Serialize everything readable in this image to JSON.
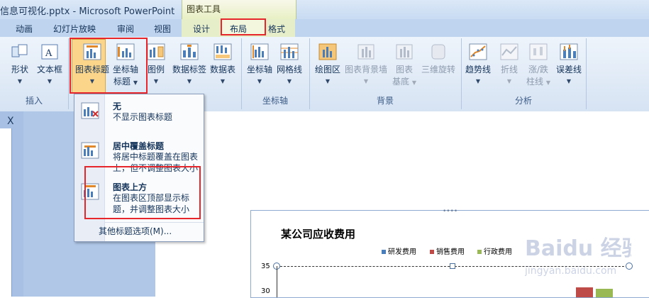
{
  "window": {
    "title": "信息可视化.pptx - Microsoft PowerPoint",
    "context_tab_group": "图表工具"
  },
  "tabs": [
    "动画",
    "幻灯片放映",
    "审阅",
    "视图",
    "设计",
    "布局",
    "格式"
  ],
  "active_tab": "布局",
  "ribbon": {
    "groups": {
      "insert": {
        "label": "插入",
        "shape": "形状",
        "textbox": "文本框"
      },
      "labels": {
        "chart_title_1": "图表标题",
        "axis_title_1": "坐标轴",
        "axis_title_2": "标题",
        "legend": "图例",
        "data_labels": "数据标签",
        "data_table": "数据表"
      },
      "axes": {
        "label": "坐标轴",
        "axes": "坐标轴",
        "gridlines": "网格线"
      },
      "background": {
        "label": "背景",
        "plot_area": "绘图区",
        "chart_wall": "图表背景墙",
        "chart_floor_1": "图表",
        "chart_floor_2": "基底",
        "rotation_3d": "三维旋转"
      },
      "analysis": {
        "label": "分析",
        "trendline": "趋势线",
        "lines": "折线",
        "updown_1": "涨/跌",
        "updown_2": "柱线",
        "error_bars": "误差线"
      }
    }
  },
  "menu": {
    "items": [
      {
        "heading": "无",
        "desc": "不显示图表标题"
      },
      {
        "heading": "居中覆盖标题",
        "desc": "将居中标题覆盖在图表上，但不调整图表大小"
      },
      {
        "heading": "图表上方",
        "desc": "在图表区顶部显示标题，并调整图表大小"
      }
    ],
    "more": "其他标题选项(M)..."
  },
  "chart": {
    "title": "某公司应收费用",
    "legend": [
      {
        "name": "研发费用",
        "color": "#4a7ebb"
      },
      {
        "name": "销售费用",
        "color": "#be4b48"
      },
      {
        "name": "行政费用",
        "color": "#98b954"
      }
    ],
    "y_ticks": [
      "35",
      "30"
    ]
  },
  "left_pane": {
    "close": "X"
  }
}
